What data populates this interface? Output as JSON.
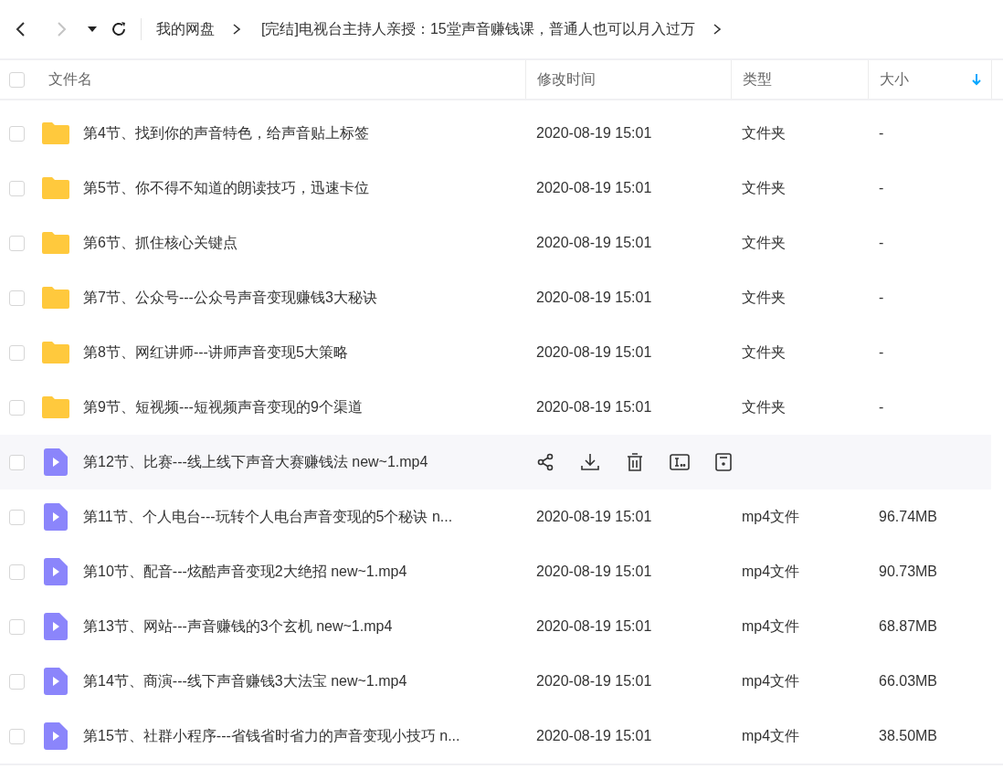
{
  "toolbar": {
    "back": {
      "disabled": false
    },
    "forward": {
      "disabled": true
    },
    "breadcrumbs": [
      {
        "label": "我的网盘"
      },
      {
        "label": "[完结]电视台主持人亲授：15堂声音赚钱课，普通人也可以月入过万"
      }
    ]
  },
  "table": {
    "select_all": {
      "checked": false
    },
    "columns": [
      {
        "label": "文件名",
        "sorted": false
      },
      {
        "label": "修改时间",
        "sorted": false
      },
      {
        "label": "类型",
        "sorted": false
      },
      {
        "label": "大小",
        "sorted": true
      }
    ],
    "rows": [
      {
        "kind": "folder",
        "name": "第4节、找到你的声音特色，给声音贴上标签",
        "modified": "2020-08-19 15:01",
        "type": "文件夹",
        "size": "-",
        "checked": false,
        "hovered": false
      },
      {
        "kind": "folder",
        "name": "第5节、你不得不知道的朗读技巧，迅速卡位",
        "modified": "2020-08-19 15:01",
        "type": "文件夹",
        "size": "-",
        "checked": false,
        "hovered": false
      },
      {
        "kind": "folder",
        "name": "第6节、抓住核心关键点",
        "modified": "2020-08-19 15:01",
        "type": "文件夹",
        "size": "-",
        "checked": false,
        "hovered": false
      },
      {
        "kind": "folder",
        "name": "第7节、公众号---公众号声音变现赚钱3大秘诀",
        "modified": "2020-08-19 15:01",
        "type": "文件夹",
        "size": "-",
        "checked": false,
        "hovered": false
      },
      {
        "kind": "folder",
        "name": "第8节、网红讲师---讲师声音变现5大策略",
        "modified": "2020-08-19 15:01",
        "type": "文件夹",
        "size": "-",
        "checked": false,
        "hovered": false
      },
      {
        "kind": "folder",
        "name": "第9节、短视频---短视频声音变现的9个渠道",
        "modified": "2020-08-19 15:01",
        "type": "文件夹",
        "size": "-",
        "checked": false,
        "hovered": false
      },
      {
        "kind": "video",
        "name": "第12节、比赛---线上线下声音大赛赚钱法 new~1.mp4",
        "checked": false,
        "hovered": true
      },
      {
        "kind": "video",
        "name": "第11节、个人电台---玩转个人电台声音变现的5个秘诀 n...",
        "modified": "2020-08-19 15:01",
        "type": "mp4文件",
        "size": "96.74MB",
        "checked": false,
        "hovered": false
      },
      {
        "kind": "video",
        "name": "第10节、配音---炫酷声音变现2大绝招 new~1.mp4",
        "modified": "2020-08-19 15:01",
        "type": "mp4文件",
        "size": "90.73MB",
        "checked": false,
        "hovered": false
      },
      {
        "kind": "video",
        "name": "第13节、网站---声音赚钱的3个玄机 new~1.mp4",
        "modified": "2020-08-19 15:01",
        "type": "mp4文件",
        "size": "68.87MB",
        "checked": false,
        "hovered": false
      },
      {
        "kind": "video",
        "name": "第14节、商演---线下声音赚钱3大法宝 new~1.mp4",
        "modified": "2020-08-19 15:01",
        "type": "mp4文件",
        "size": "66.03MB",
        "checked": false,
        "hovered": false
      },
      {
        "kind": "video",
        "name": "第15节、社群小程序---省钱省时省力的声音变现小技巧 n...",
        "modified": "2020-08-19 15:01",
        "type": "mp4文件",
        "size": "38.50MB",
        "checked": false,
        "hovered": false
      }
    ]
  }
}
